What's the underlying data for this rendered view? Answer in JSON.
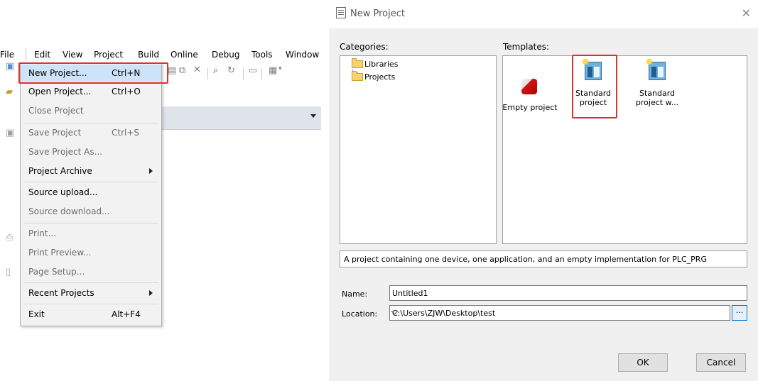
{
  "menubar": {
    "items": [
      "File",
      "Edit",
      "View",
      "Project",
      "Build",
      "Online",
      "Debug",
      "Tools",
      "Window"
    ]
  },
  "file_menu": {
    "items": [
      {
        "label": "New Project...",
        "shortcut": "Ctrl+N",
        "enabled": true,
        "highlighted": true
      },
      {
        "label": "Open Project...",
        "shortcut": "Ctrl+O",
        "enabled": true
      },
      {
        "label": "Close Project",
        "shortcut": "",
        "enabled": false
      },
      {
        "label": "Save Project",
        "shortcut": "Ctrl+S",
        "enabled": false
      },
      {
        "label": "Save Project As...",
        "shortcut": "",
        "enabled": false
      },
      {
        "label": "Project Archive",
        "shortcut": "",
        "enabled": true,
        "submenu": true
      },
      {
        "label": "Source upload...",
        "shortcut": "",
        "enabled": true
      },
      {
        "label": "Source download...",
        "shortcut": "",
        "enabled": false
      },
      {
        "label": "Print...",
        "shortcut": "",
        "enabled": false
      },
      {
        "label": "Print Preview...",
        "shortcut": "",
        "enabled": false
      },
      {
        "label": "Page Setup...",
        "shortcut": "",
        "enabled": false
      },
      {
        "label": "Recent Projects",
        "shortcut": "",
        "enabled": true,
        "submenu": true
      },
      {
        "label": "Exit",
        "shortcut": "Alt+F4",
        "enabled": true
      }
    ]
  },
  "dialog": {
    "title": "New Project",
    "categories_label": "Categories:",
    "templates_label": "Templates:",
    "categories": [
      "Libraries",
      "Projects"
    ],
    "templates": [
      {
        "label_line1": "Empty project",
        "label_line2": "",
        "icon": "red-cube-icon"
      },
      {
        "label_line1": "Standard",
        "label_line2": "project",
        "icon": "standard-project-icon",
        "selected": true
      },
      {
        "label_line1": "Standard",
        "label_line2": "project w...",
        "icon": "standard-project-icon"
      }
    ],
    "description": "A project containing one device, one application, and an empty implementation for PLC_PRG",
    "name_label": "Name:",
    "name_value": "Untitled1",
    "location_label": "Location:",
    "location_value": "C:\\Users\\ZJW\\Desktop\\test",
    "browse_label": "...",
    "ok_label": "OK",
    "cancel_label": "Cancel"
  },
  "colors": {
    "highlight": "#cde3f7",
    "callout_red": "#e03131",
    "dialog_bg": "#f0f0f0"
  }
}
